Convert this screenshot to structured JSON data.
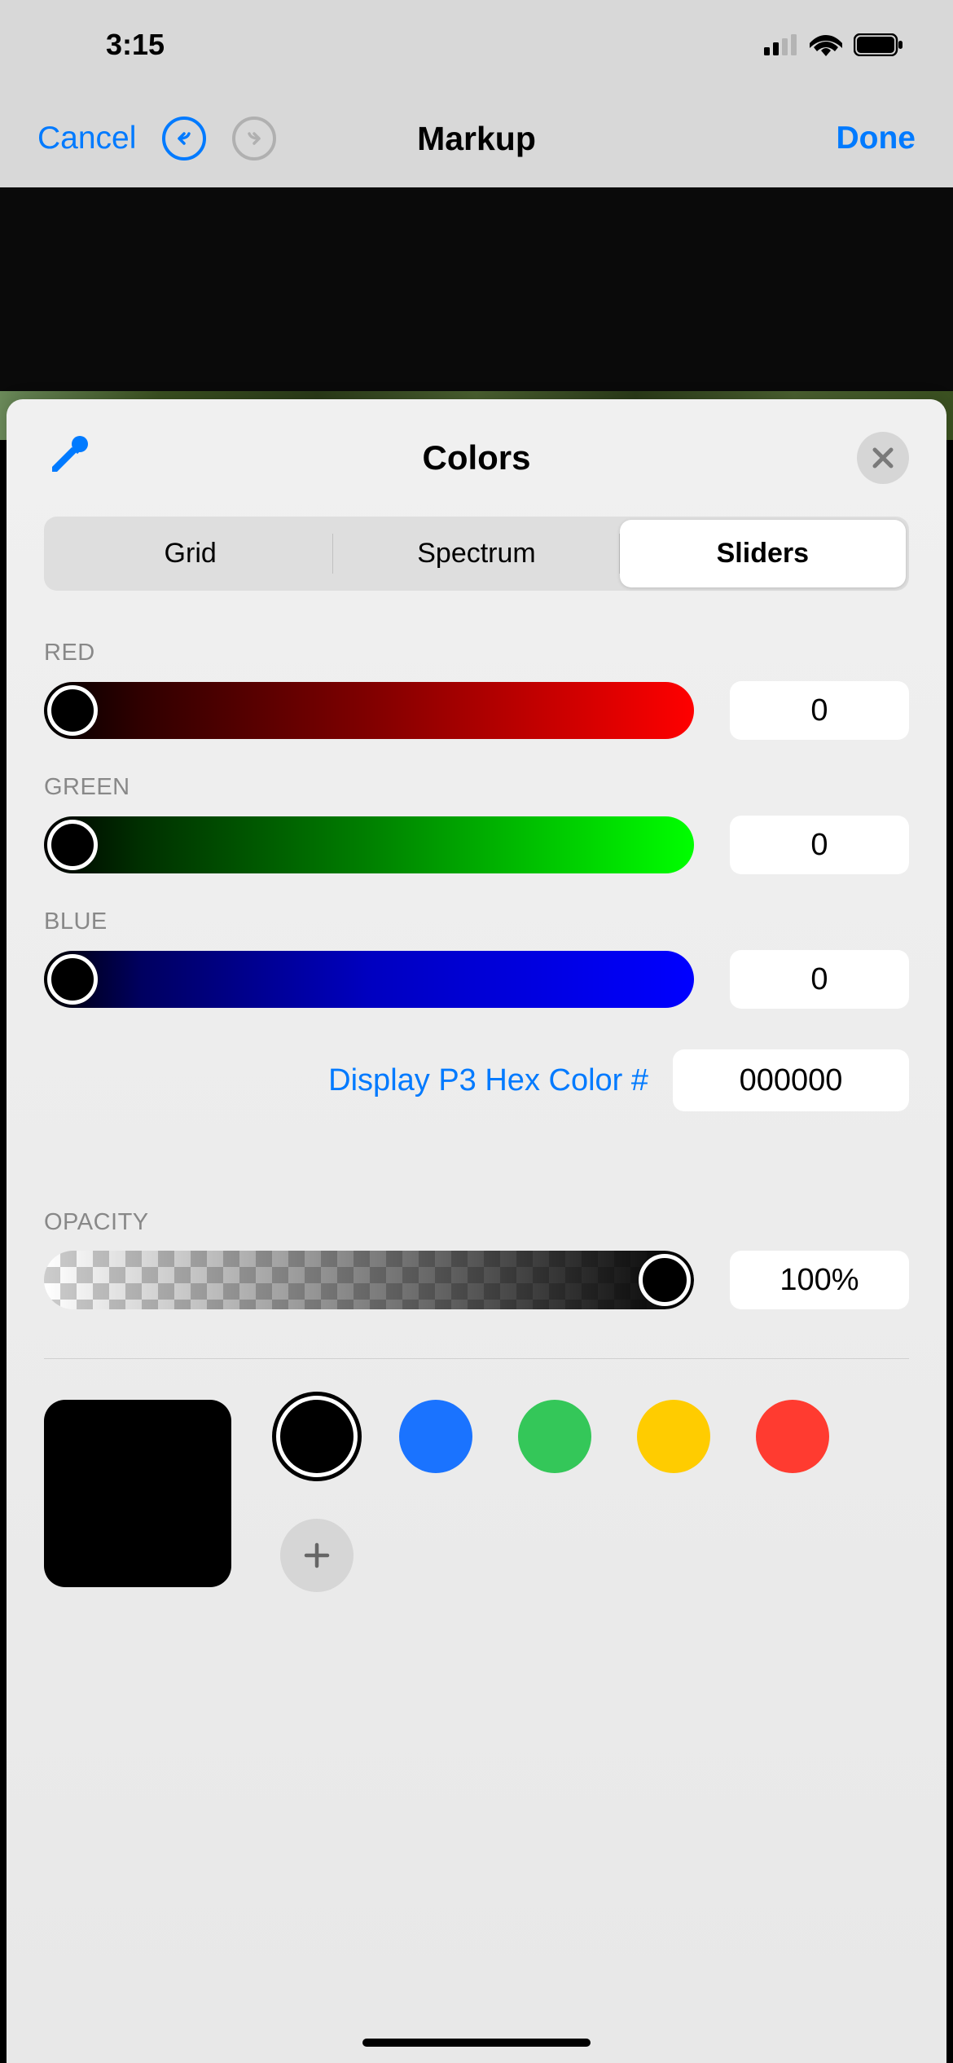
{
  "status": {
    "time": "3:15"
  },
  "nav": {
    "cancel": "Cancel",
    "title": "Markup",
    "done": "Done"
  },
  "panel": {
    "title": "Colors",
    "tabs": [
      "Grid",
      "Spectrum",
      "Sliders"
    ],
    "activeTab": "Sliders"
  },
  "sliders": {
    "red": {
      "label": "RED",
      "value": "0"
    },
    "green": {
      "label": "GREEN",
      "value": "0"
    },
    "blue": {
      "label": "BLUE",
      "value": "0"
    }
  },
  "hex": {
    "label": "Display P3 Hex Color #",
    "value": "000000"
  },
  "opacity": {
    "label": "OPACITY",
    "value": "100%"
  },
  "swatches": {
    "current": "#000000",
    "presets": [
      {
        "color": "#000000",
        "selected": true
      },
      {
        "color": "#1a73ff",
        "selected": false
      },
      {
        "color": "#34c759",
        "selected": false
      },
      {
        "color": "#ffcc00",
        "selected": false
      },
      {
        "color": "#ff3b30",
        "selected": false
      }
    ]
  }
}
